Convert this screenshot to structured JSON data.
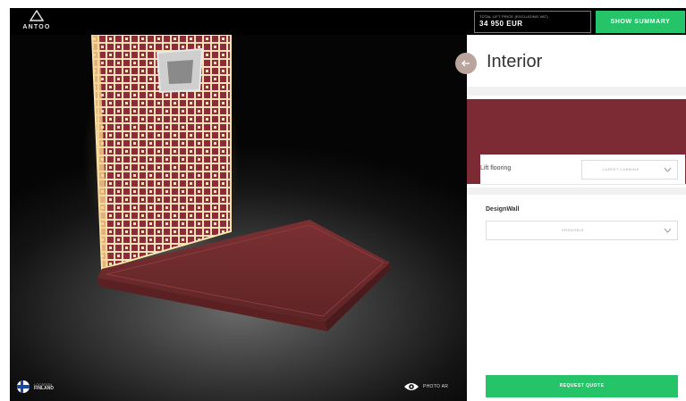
{
  "header": {
    "logo_text": "ANTOO",
    "price_caption": "TOTAL LIFT PRICE (EXCLUDING VAT)",
    "price_value": "34 950 EUR",
    "summary_label": "SHOW SUMMARY"
  },
  "viewer": {
    "location_caption": "LOCATION",
    "location_country": "FINLAND",
    "photo_ar_label": "PHOTO AR"
  },
  "panel": {
    "title": "Interior",
    "swatch_color": "#7c2a34",
    "flooring_label": "Lift flooring",
    "flooring_value": "CARPET CARMINE",
    "designwall_label": "DesignWall",
    "designwall_value": "GRENOBLE",
    "quote_label": "REQUEST QUOTE"
  },
  "colors": {
    "accent_green": "#25c469",
    "wall_red": "#8e2a3a",
    "floor_red": "#6e2a2c"
  },
  "icons": [
    "logo-triangle-icon",
    "back-arrow-icon",
    "chevron-down-icon",
    "finland-flag-icon",
    "eye-icon"
  ]
}
